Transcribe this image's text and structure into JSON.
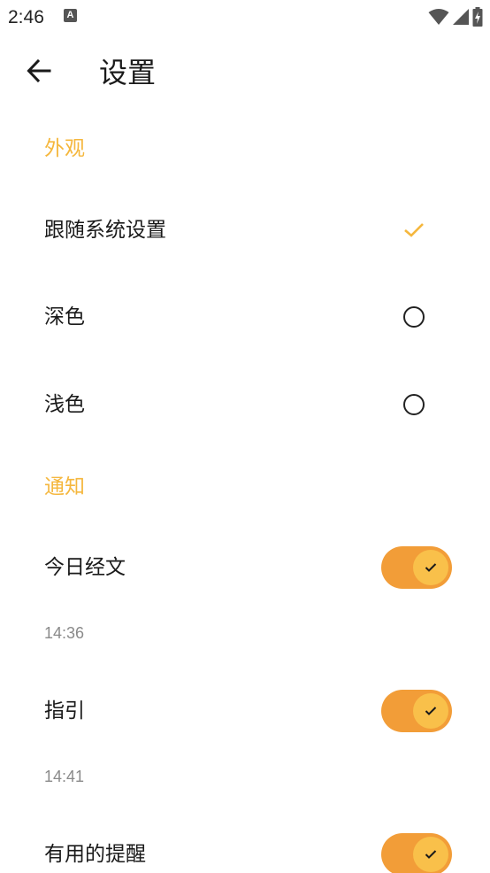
{
  "status_bar": {
    "time": "2:46",
    "notification_glyph": "A",
    "icons": [
      "wifi-icon",
      "cell-signal-icon",
      "battery-charging-icon"
    ]
  },
  "app_bar": {
    "title": "设置",
    "back_icon": "arrow-left-icon"
  },
  "appearance": {
    "header": "外观",
    "options": [
      {
        "label": "跟随系统设置",
        "selected": true
      },
      {
        "label": "深色",
        "selected": false
      },
      {
        "label": "浅色",
        "selected": false
      }
    ]
  },
  "notifications": {
    "header": "通知",
    "items": [
      {
        "label": "今日经文",
        "time": "14:36",
        "enabled": true
      },
      {
        "label": "指引",
        "time": "14:41",
        "enabled": true
      },
      {
        "label": "有用的提醒",
        "enabled": true
      }
    ]
  },
  "colors": {
    "accent": "#f5b73d",
    "toggle_track": "#f29d38",
    "toggle_knob": "#f9c04a",
    "secondary_text": "#8a8a8a"
  }
}
